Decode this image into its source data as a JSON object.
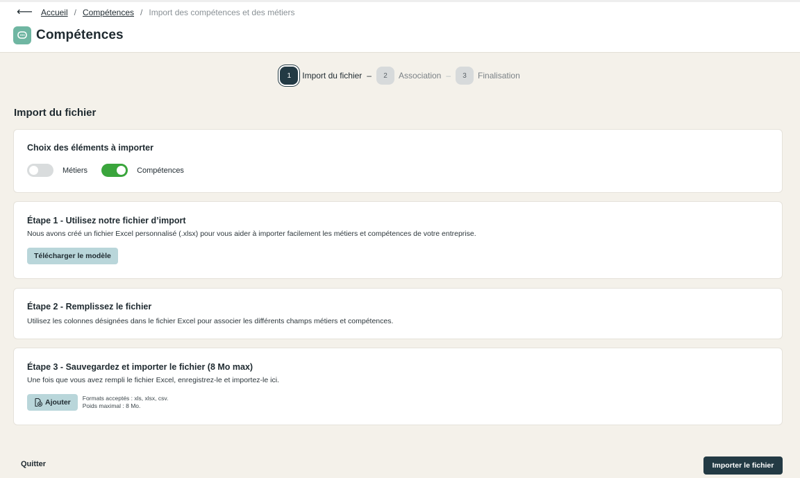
{
  "breadcrumb": {
    "back_icon": "arrow-left-icon",
    "items": [
      "Accueil",
      "Compétences"
    ],
    "current": "Import des compétences et des métiers"
  },
  "header": {
    "title": "Compétences",
    "icon": "chat-bubble-icon",
    "icon_color": "#6fb6a2"
  },
  "stepper": {
    "steps": [
      {
        "number": "1",
        "label": "Import du fichier"
      },
      {
        "number": "2",
        "label": "Association"
      },
      {
        "number": "3",
        "label": "Finalisation"
      }
    ],
    "active_index": 0
  },
  "section_title": "Import du fichier",
  "choice_card": {
    "title": "Choix des éléments à importer",
    "toggles": [
      {
        "label": "Métiers",
        "on": false
      },
      {
        "label": "Compétences",
        "on": true
      }
    ],
    "toggle_on_color": "#3aa53c"
  },
  "step1_card": {
    "title": "Étape 1 - Utilisez notre fichier d’import",
    "text": "Nous avons créé un fichier Excel personnalisé (.xlsx) pour vous aider à importer facilement les métiers et compétences de votre entreprise.",
    "button": "Télécharger le modèle"
  },
  "step2_card": {
    "title": "Étape 2 - Remplissez le fichier",
    "text": "Utilisez les colonnes désignées dans le fichier Excel pour associer les différents champs métiers et compétences."
  },
  "step3_card": {
    "title": "Étape 3 - Sauvegardez et importer le fichier (8 Mo max)",
    "text": "Une fois que vous avez rempli le fichier Excel, enregistrez-le et importez-le ici.",
    "button": "Ajouter",
    "button_icon": "file-add-icon",
    "hint_formats": "Formats acceptés : xls, xlsx, csv.",
    "hint_size": "Poids maximal : 8 Mo."
  },
  "footer": {
    "quit": "Quitter",
    "import": "Importer le fichier"
  },
  "colors": {
    "primary": "#233a44",
    "secondary_button": "#b9d6da",
    "background": "#f4f1ea"
  }
}
